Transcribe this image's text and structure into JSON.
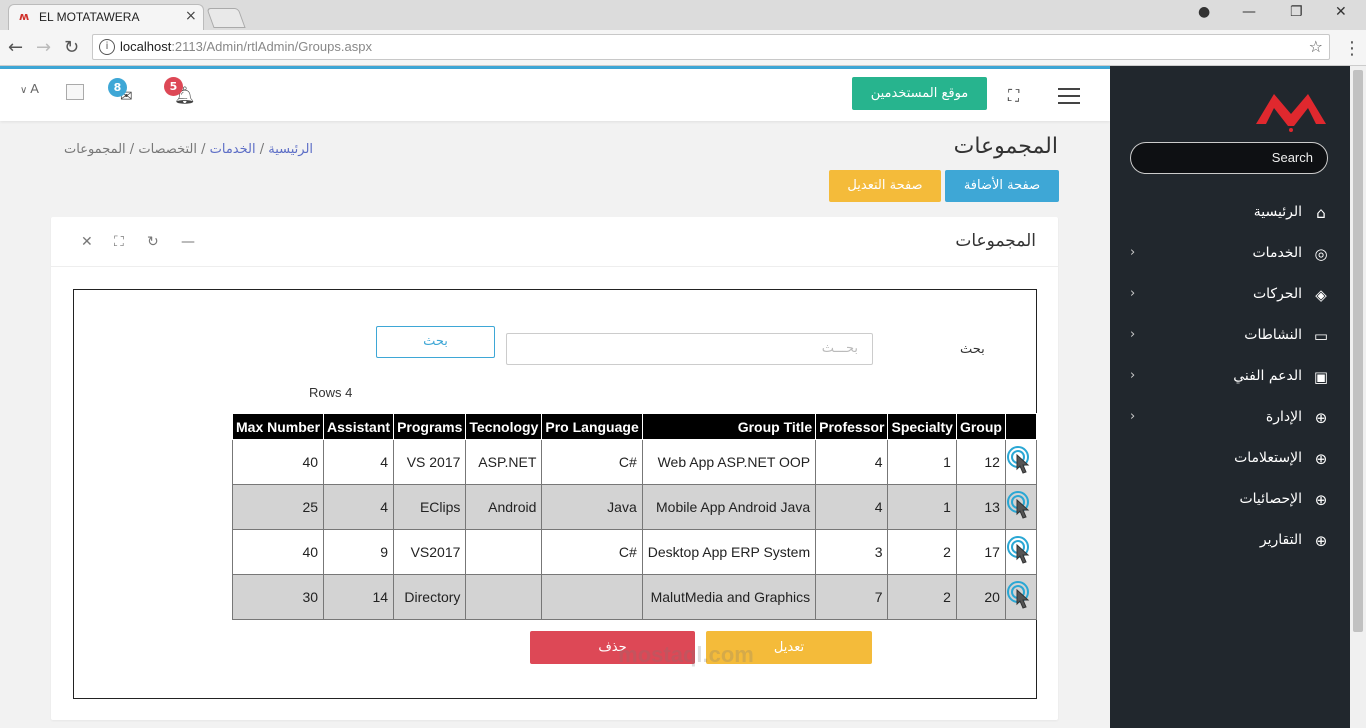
{
  "browser": {
    "tab_title": "EL MOTATAWERA",
    "url_host": "localhost",
    "url_path": ":2113/Admin/rtlAdmin/Groups.aspx"
  },
  "header": {
    "site_button": "موقع المستخدمين",
    "notifications_count": "5",
    "messages_count": "8",
    "user_label": "A"
  },
  "sidebar": {
    "search_placeholder": "Search",
    "items": [
      {
        "label": "الرئيسية",
        "icon": "home-icon",
        "has_children": false
      },
      {
        "label": "الخدمات",
        "icon": "life-ring-icon",
        "has_children": true
      },
      {
        "label": "الحركات",
        "icon": "layers-icon",
        "has_children": true
      },
      {
        "label": "النشاطات",
        "icon": "monitor-icon",
        "has_children": true
      },
      {
        "label": "الدعم الفني",
        "icon": "briefcase-icon",
        "has_children": true
      },
      {
        "label": "الإدارة",
        "icon": "globe-icon",
        "has_children": true
      },
      {
        "label": "الإستعلامات",
        "icon": "globe-icon",
        "has_children": false
      },
      {
        "label": "الإحصائيات",
        "icon": "globe-icon",
        "has_children": false
      },
      {
        "label": "التقارير",
        "icon": "globe-icon",
        "has_children": false
      }
    ]
  },
  "page": {
    "title": "المجموعات",
    "breadcrumb": [
      "الرئيسية",
      "الخدمات",
      "التخصصات",
      "المجموعات"
    ],
    "add_page_button": "صفحة الأضافة",
    "edit_page_button": "صفحة التعديل"
  },
  "card": {
    "title": "المجموعات",
    "search_label": "بحث",
    "search_placeholder": "بحـــث",
    "search_button": "بحث",
    "rows_count": "Rows 4",
    "columns": [
      "Max Number",
      "Assistant",
      "Programs",
      "Tecnology",
      "Pro Language",
      "Group Title",
      "Professor",
      "Specialty",
      "Group"
    ],
    "rows": [
      [
        "40",
        "4",
        "VS 2017",
        "ASP.NET",
        "C#",
        "Web App ASP.NET OOP",
        "4",
        "1",
        "12"
      ],
      [
        "25",
        "4",
        "EClips",
        "Android",
        "Java",
        "Mobile App Android Java",
        "4",
        "1",
        "13"
      ],
      [
        "40",
        "9",
        "VS2017",
        "",
        "C#",
        "Desktop App ERP System",
        "3",
        "2",
        "17"
      ],
      [
        "30",
        "14",
        "Directory",
        "",
        "",
        "MalutMedia and Graphics",
        "7",
        "2",
        "20"
      ]
    ],
    "update_button": "تعديل",
    "delete_button": "حذف"
  },
  "watermark": "mostaql.com",
  "colors": {
    "sidebar_bg": "#21272d",
    "primary": "#3ea7d6",
    "success": "#27b48e",
    "warning": "#f4bb3a",
    "danger": "#dd4856"
  }
}
